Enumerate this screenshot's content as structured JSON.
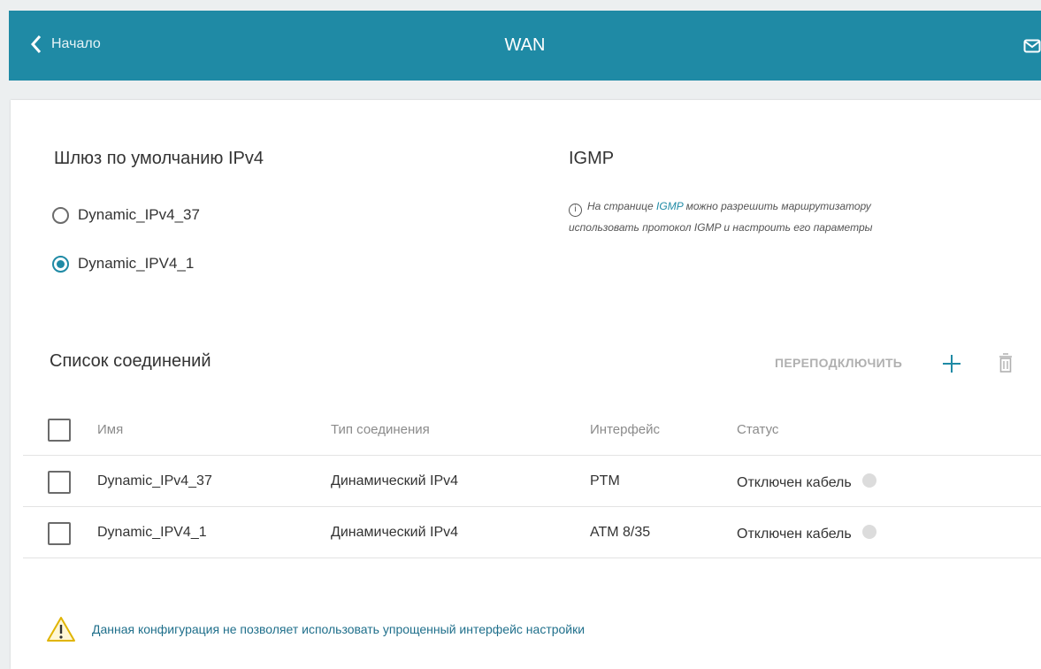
{
  "header": {
    "back_label": "Начало",
    "title": "WAN",
    "accent": "#1f8aa5"
  },
  "gateway": {
    "title": "Шлюз по умолчанию IPv4",
    "options": [
      {
        "label": "Dynamic_IPv4_37",
        "selected": false
      },
      {
        "label": "Dynamic_IPV4_1",
        "selected": true
      }
    ]
  },
  "igmp": {
    "title": "IGMP",
    "info_before": "На странице ",
    "info_link": "IGMP",
    "info_after": " можно разрешить маршрутизатору использовать протокол IGMP и настроить его параметры"
  },
  "connections": {
    "title": "Список соединений",
    "reconnect_label": "ПЕРЕПОДКЛЮЧИТЬ",
    "columns": [
      "Имя",
      "Тип соединения",
      "Интерфейс",
      "Статус"
    ],
    "rows": [
      {
        "name": "Dynamic_IPv4_37",
        "type": "Динамический IPv4",
        "iface": "PTM",
        "status": "Отключен кабель"
      },
      {
        "name": "Dynamic_IPV4_1",
        "type": "Динамический IPv4",
        "iface": "ATM 8/35",
        "status": "Отключен кабель"
      }
    ]
  },
  "warning": {
    "text": "Данная конфигурация не позволяет использовать упрощенный интерфейс настройки"
  }
}
